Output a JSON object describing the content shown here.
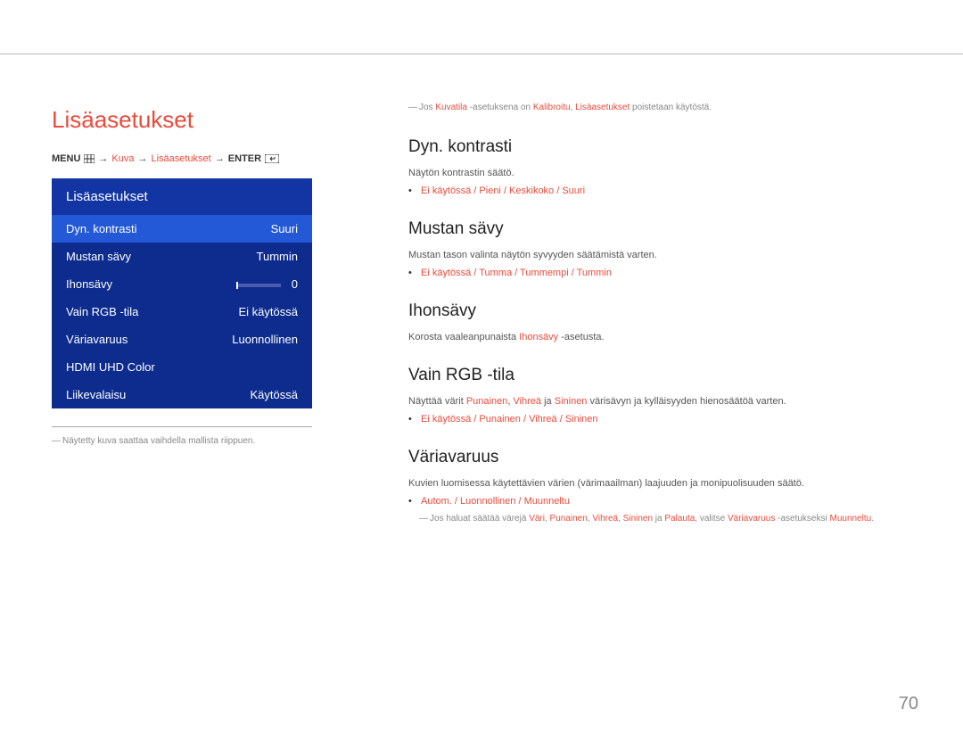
{
  "page_title": "Lisäasetukset",
  "breadcrumb": {
    "menu_label": "MENU",
    "seg1": "Kuva",
    "seg2": "Lisäasetukset",
    "enter_label": "ENTER"
  },
  "menu_widget": {
    "header": "Lisäasetukset",
    "rows": [
      {
        "label": "Dyn. kontrasti",
        "value": "Suuri",
        "selected": true
      },
      {
        "label": "Mustan sävy",
        "value": "Tummin"
      },
      {
        "label": "Ihonsävy",
        "value": "0",
        "slider": true
      },
      {
        "label": "Vain RGB -tila",
        "value": "Ei käytössä"
      },
      {
        "label": "Väriavaruus",
        "value": "Luonnollinen"
      },
      {
        "label": "HDMI UHD Color",
        "value": ""
      },
      {
        "label": "Liikevalaisu",
        "value": "Käytössä"
      }
    ]
  },
  "left_footnote": "Näytetty kuva saattaa vaihdella mallista riippuen.",
  "right": {
    "top_note": {
      "t1": "Jos ",
      "o1": "Kuvatila",
      "t2": " -asetuksena on ",
      "o2": "Kalibroitu",
      "t3": ", ",
      "o3": "Lisäasetukset",
      "t4": " poistetaan käytöstä."
    },
    "sections": {
      "dyn": {
        "title": "Dyn. kontrasti",
        "desc": "Näytön kontrastin säätö.",
        "opts": "Ei käytössä / Pieni / Keskikoko / Suuri"
      },
      "mustan": {
        "title": "Mustan sävy",
        "desc": "Mustan tason valinta näytön syvyyden säätämistä varten.",
        "opts": "Ei käytössä / Tumma / Tummempi / Tummin"
      },
      "ihon": {
        "title": "Ihonsävy",
        "desc": {
          "t1": "Korosta vaaleanpunaista ",
          "o1": "Ihonsävy",
          "t2": " -asetusta."
        }
      },
      "rgb": {
        "title": "Vain RGB -tila",
        "desc": {
          "t1": "Näyttää värit ",
          "o1": "Punainen",
          "t2": ", ",
          "o2": "Vihreä",
          "t3": " ja ",
          "o3": "Sininen",
          "t4": " värisävyn ja kylläisyyden hienosäätöä varten."
        },
        "opts": "Ei käytössä / Punainen / Vihreä / Sininen"
      },
      "vari": {
        "title": "Väriavaruus",
        "desc": "Kuvien luomisessa käytettävien värien (värimaailman) laajuuden ja monipuolisuuden säätö.",
        "opts": "Autom. / Luonnollinen / Muunneltu",
        "subnote": {
          "t1": "Jos haluat säätää värejä ",
          "o1": "Väri",
          "t2": ", ",
          "o2": "Punainen",
          "t3": ", ",
          "o3": "Vihreä",
          "t4": ", ",
          "o4": "Sininen",
          "t5": " ja ",
          "o5": "Palauta",
          "t6": ", valitse ",
          "o6": "Väriavaruus",
          "t7": " -asetukseksi ",
          "o7": "Muunneltu",
          "t8": "."
        }
      }
    }
  },
  "page_number": "70"
}
